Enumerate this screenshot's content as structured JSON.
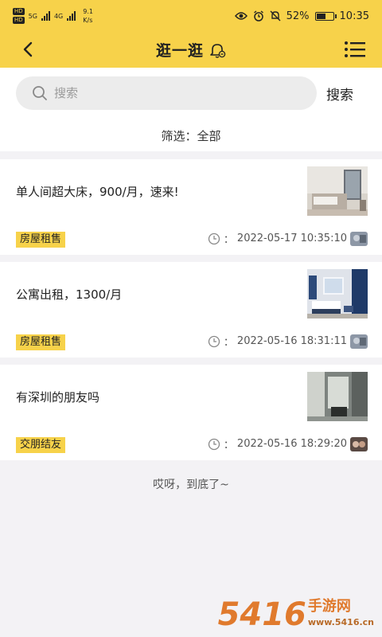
{
  "status_bar": {
    "sim1": "HD",
    "sim2": "HD",
    "network1": "5G",
    "network2": "4G",
    "speed_value": "9.1",
    "speed_unit": "K/s",
    "battery": "52%",
    "time": "10:35"
  },
  "header": {
    "title": "逛一逛"
  },
  "search": {
    "placeholder": "搜索",
    "button_label": "搜索"
  },
  "filter": {
    "label": "筛选：全部"
  },
  "posts": [
    {
      "title": "单人间超大床，900/月，速来!",
      "tag": "房屋租售",
      "time": "2022-05-17 10:35:10"
    },
    {
      "title": "公寓出租，1300/月",
      "tag": "房屋租售",
      "time": "2022-05-16 18:31:11"
    },
    {
      "title": "有深圳的朋友吗",
      "tag": "交朋结友",
      "time": "2022-05-16 18:29:20"
    }
  ],
  "clock_separator": "：",
  "footer": {
    "end_text": "哎呀，到底了~"
  },
  "watermark": {
    "big": "5416",
    "small1": "手游网",
    "small2": "www.5416.cn"
  },
  "colors": {
    "accent": "#f7d24a",
    "background": "#f3f2f5",
    "card": "#ffffff"
  }
}
